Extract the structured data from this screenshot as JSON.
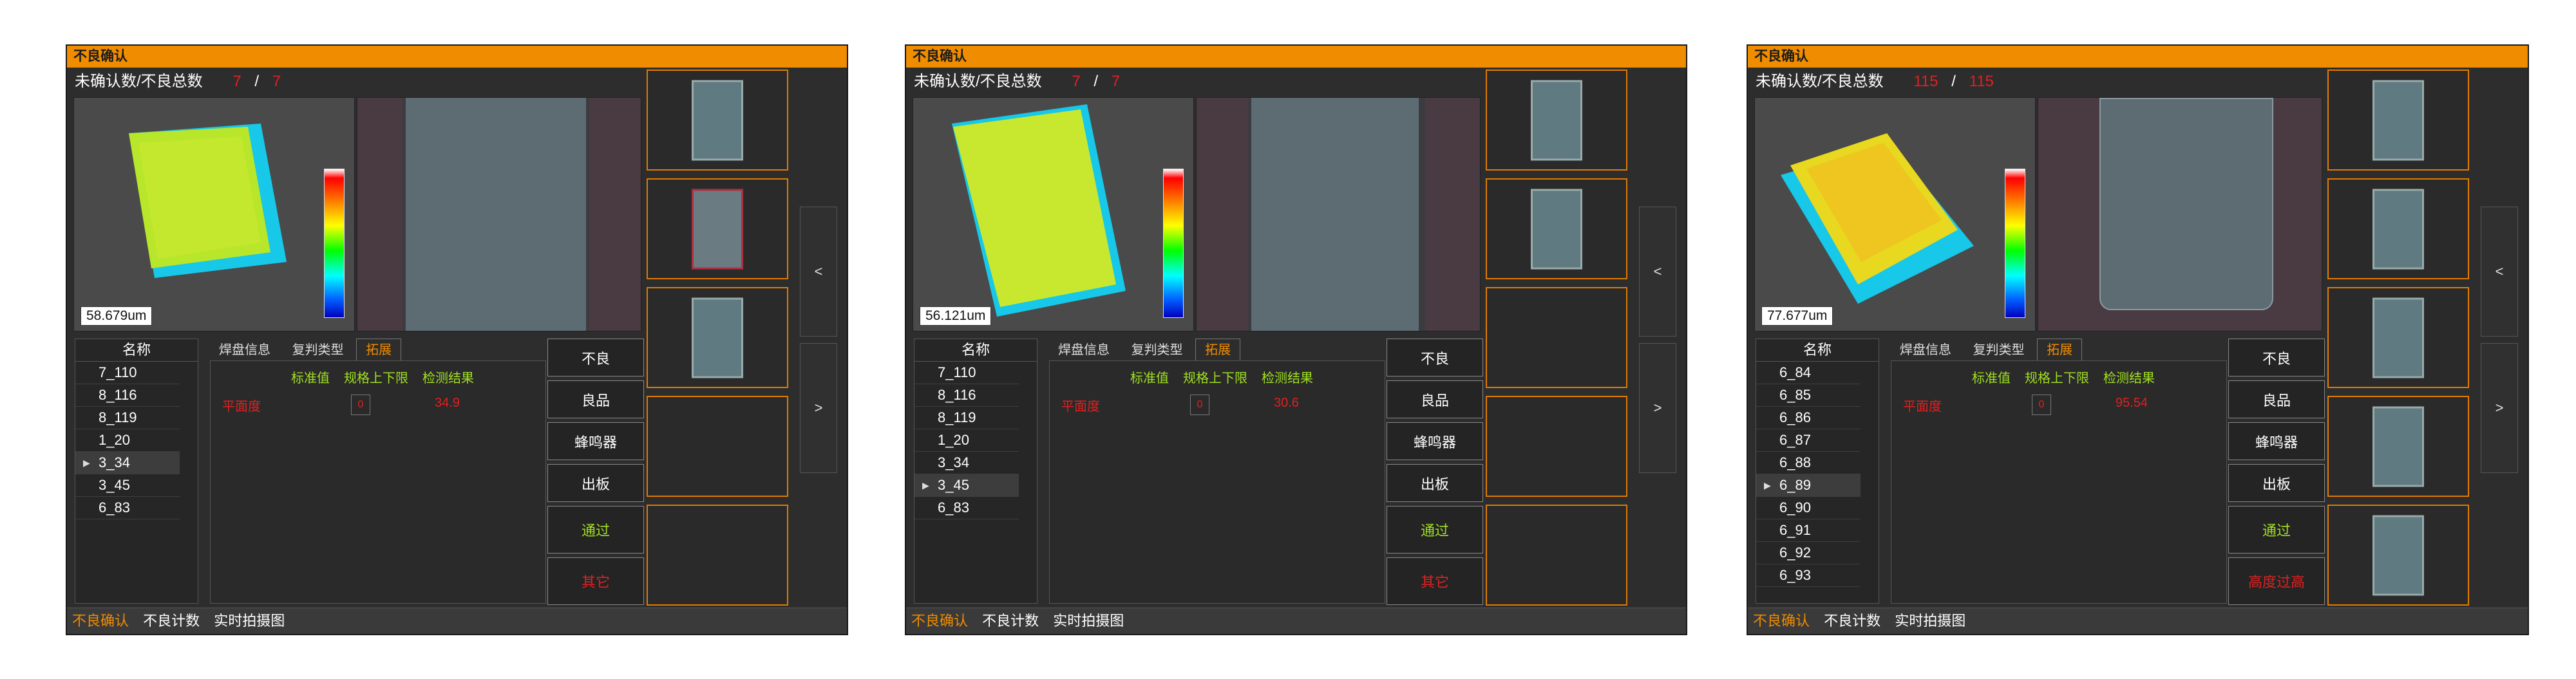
{
  "colors": {
    "title_bar": "#f08c00",
    "accent_red": "#e02020",
    "accent_green": "#a0e020",
    "panel_bg": "#2d2d2d"
  },
  "panels": [
    {
      "title": "不良确认",
      "count_label": "未确认数/不良总数",
      "unconfirmed": "7",
      "separator": "/",
      "total": "7",
      "measurement": "58.679um",
      "list_header": "名称",
      "list_items": [
        "7_110",
        "8_116",
        "8_119",
        "1_20",
        "3_34",
        "3_45",
        "6_83"
      ],
      "selected_index": 4,
      "tabs": [
        "焊盘信息",
        "复判类型",
        "拓展"
      ],
      "active_tab": 2,
      "col_headers": [
        "标准值",
        "规格上下限",
        "检测结果"
      ],
      "row_label": "平面度",
      "row_box": "0",
      "row_value": "34.9",
      "buttons": [
        "不良",
        "良品",
        "蜂鸣器",
        "出板"
      ],
      "green_button": "通过",
      "red_button": "其它",
      "bottom_tabs": [
        "不良确认",
        "不良计数",
        "实时拍摄图"
      ],
      "nav_prev": "<",
      "nav_next": ">",
      "thumb_count": 3
    },
    {
      "title": "不良确认",
      "count_label": "未确认数/不良总数",
      "unconfirmed": "7",
      "separator": "/",
      "total": "7",
      "measurement": "56.121um",
      "list_header": "名称",
      "list_items": [
        "7_110",
        "8_116",
        "8_119",
        "1_20",
        "3_34",
        "3_45",
        "6_83"
      ],
      "selected_index": 5,
      "tabs": [
        "焊盘信息",
        "复判类型",
        "拓展"
      ],
      "active_tab": 2,
      "col_headers": [
        "标准值",
        "规格上下限",
        "检测结果"
      ],
      "row_label": "平面度",
      "row_box": "0",
      "row_value": "30.6",
      "buttons": [
        "不良",
        "良品",
        "蜂鸣器",
        "出板"
      ],
      "green_button": "通过",
      "red_button": "其它",
      "bottom_tabs": [
        "不良确认",
        "不良计数",
        "实时拍摄图"
      ],
      "nav_prev": "<",
      "nav_next": ">",
      "thumb_count": 2
    },
    {
      "title": "不良确认",
      "count_label": "未确认数/不良总数",
      "unconfirmed": "115",
      "separator": "/",
      "total": "115",
      "measurement": "77.677um",
      "list_header": "名称",
      "list_items": [
        "6_84",
        "6_85",
        "6_86",
        "6_87",
        "6_88",
        "6_89",
        "6_90",
        "6_91",
        "6_92",
        "6_93"
      ],
      "selected_index": 5,
      "tabs": [
        "焊盘信息",
        "复判类型",
        "拓展"
      ],
      "active_tab": 2,
      "col_headers": [
        "标准值",
        "规格上下限",
        "检测结果"
      ],
      "row_label": "平面度",
      "row_box": "0",
      "row_value": "95.54",
      "buttons": [
        "不良",
        "良品",
        "蜂鸣器",
        "出板"
      ],
      "green_button": "通过",
      "red_button": "高度过高",
      "bottom_tabs": [
        "不良确认",
        "不良计数",
        "实时拍摄图"
      ],
      "nav_prev": "<",
      "nav_next": ">",
      "thumb_count": 5
    }
  ]
}
